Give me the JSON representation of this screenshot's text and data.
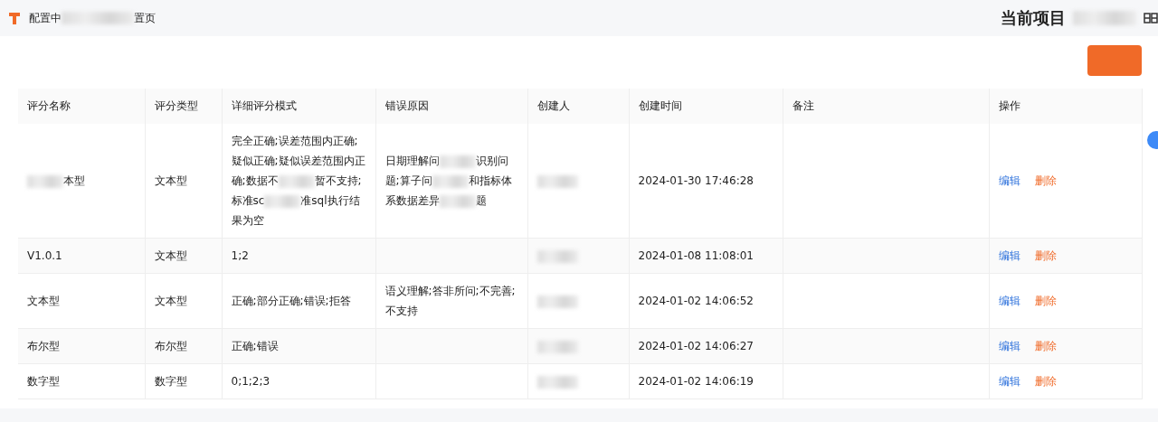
{
  "header": {
    "title_start": "配置中",
    "title_end": "置页",
    "project_label": "当前项目"
  },
  "table": {
    "columns": [
      "评分名称",
      "评分类型",
      "详细评分模式",
      "错误原因",
      "创建人",
      "创建时间",
      "备注",
      "操作"
    ],
    "rows": [
      {
        "name": {
          "parts": [
            "本型"
          ],
          "lead_blur": true
        },
        "type": "文本型",
        "detail": {
          "parts": [
            "完全正确;误差范围内正确;疑似正确;疑似误差范围内正确;数据不",
            "暂不支持;标准sc",
            "准sql执行结果为空"
          ]
        },
        "reason": {
          "parts": [
            "日期理解问",
            "识别问题;算子问",
            "和指标体系数据差异",
            "题"
          ]
        },
        "creator_redacted": true,
        "time": "2024-01-30 17:46:28",
        "actions": [
          "编辑",
          "删除"
        ]
      },
      {
        "name": "V1.0.1",
        "type": "文本型",
        "detail": "1;2",
        "creator_redacted": true,
        "time": "2024-01-08 11:08:01",
        "actions": [
          "编辑",
          "删除"
        ]
      },
      {
        "name": "文本型",
        "type": "文本型",
        "detail": "正确;部分正确;错误;拒答",
        "reason": "语义理解;答非所问;不完善;不支持",
        "creator_redacted": true,
        "time": "2024-01-02 14:06:52",
        "actions": [
          "编辑",
          "删除"
        ]
      },
      {
        "name": "布尔型",
        "type": "布尔型",
        "detail": "正确;错误",
        "creator_redacted": true,
        "time": "2024-01-02 14:06:27",
        "actions": [
          "编辑",
          "删除"
        ]
      },
      {
        "name": "数字型",
        "type": "数字型",
        "detail": "0;1;2;3",
        "creator_redacted": true,
        "time": "2024-01-02 14:06:19",
        "actions": [
          "编辑",
          "删除"
        ]
      }
    ]
  }
}
